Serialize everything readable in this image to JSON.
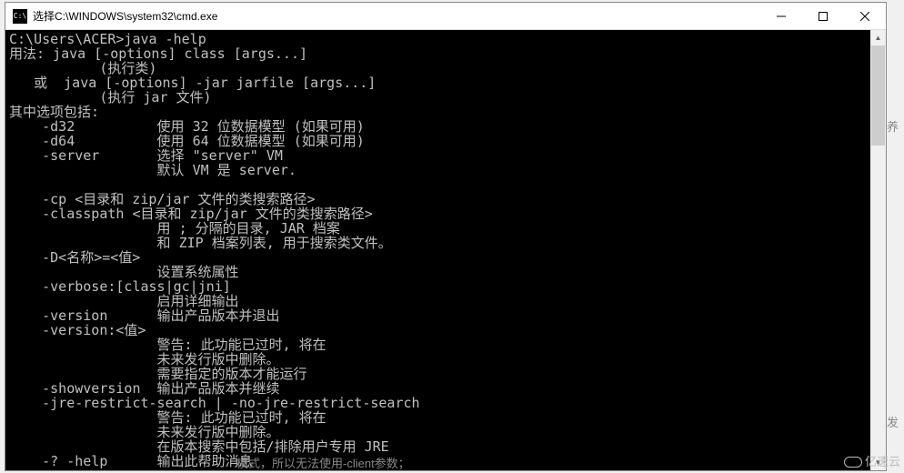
{
  "window": {
    "title": "选择C:\\WINDOWS\\system32\\cmd.exe"
  },
  "console": {
    "lines": [
      "C:\\Users\\ACER>java -help",
      "用法: java [-options] class [args...]",
      "           (执行类)",
      "   或  java [-options] -jar jarfile [args...]",
      "           (执行 jar 文件)",
      "其中选项包括:",
      "    -d32          使用 32 位数据模型 (如果可用)",
      "    -d64          使用 64 位数据模型 (如果可用)",
      "    -server       选择 \"server\" VM",
      "                  默认 VM 是 server.",
      "",
      "    -cp <目录和 zip/jar 文件的类搜索路径>",
      "    -classpath <目录和 zip/jar 文件的类搜索路径>",
      "                  用 ; 分隔的目录, JAR 档案",
      "                  和 ZIP 档案列表, 用于搜索类文件。",
      "    -D<名称>=<值>",
      "                  设置系统属性",
      "    -verbose:[class|gc|jni]",
      "                  启用详细输出",
      "    -version      输出产品版本并退出",
      "    -version:<值>",
      "                  警告: 此功能已过时, 将在",
      "                  未来发行版中删除。",
      "                  需要指定的版本才能运行",
      "    -showversion  输出产品版本并继续",
      "    -jre-restrict-search | -no-jre-restrict-search",
      "                  警告: 此功能已过时, 将在",
      "                  未来发行版中删除。",
      "                  在版本搜索中包括/排除用户专用 JRE",
      "    -? -help      输出此帮助消息"
    ]
  },
  "background": {
    "text1": "养",
    "text2": "模式，所以无法使用-client参数；",
    "text3": "发"
  },
  "watermark": {
    "text": "亿速云"
  }
}
